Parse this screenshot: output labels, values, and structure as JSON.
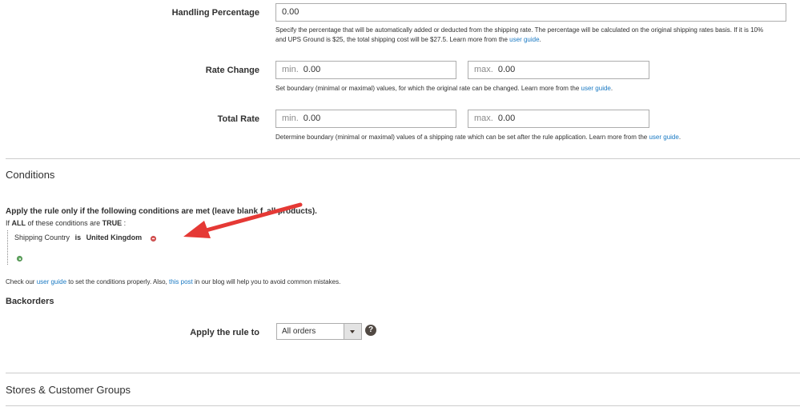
{
  "handling_percentage": {
    "label": "Handling Percentage",
    "value": "0.00",
    "note_line1": "Specify the percentage that will be automatically added or deducted from the shipping rate. The percentage will be calculated on the original shipping rates basis. If it is 10%",
    "note_line2": "and UPS Ground is $25, the total shipping cost will be $27.5. Learn more from the ",
    "note_link": "user guide",
    "note_end": "."
  },
  "rate_change": {
    "label": "Rate Change",
    "min_prefix": "min.",
    "min_value": "0.00",
    "max_prefix": "max.",
    "max_value": "0.00",
    "note": "Set boundary (minimal or maximal) values, for which the original rate can be changed. Learn more from the ",
    "note_link": "user guide",
    "note_end": "."
  },
  "total_rate": {
    "label": "Total Rate",
    "min_prefix": "min.",
    "min_value": "0.00",
    "max_prefix": "max.",
    "max_value": "0.00",
    "note": "Determine boundary (minimal or maximal) values of a shipping rate which can be set after the rule application. Learn more from the ",
    "note_link": "user guide",
    "note_end": "."
  },
  "conditions": {
    "title": "Conditions",
    "apply_text_part1": "Apply the rule only if the following conditions are met (leave blank f",
    "apply_text_part2": "all products).",
    "if_text": "If",
    "all_text": "ALL",
    "middle_text": "of these conditions are",
    "true_text": "TRUE",
    "colon": ":",
    "condition_attribute": "Shipping Country",
    "condition_operator": "is",
    "condition_value": "United Kingdom",
    "check_text": "Check our ",
    "check_link1": "user guide",
    "check_mid": " to set the conditions properly. Also, ",
    "check_link2": "this post",
    "check_end": " in our blog will help you to avoid common mistakes."
  },
  "backorders": {
    "title": "Backorders",
    "apply_label": "Apply the rule to",
    "selected": "All orders",
    "help": "?"
  },
  "stores": {
    "title": "Stores & Customer Groups"
  },
  "colors": {
    "link": "#1979c3",
    "arrow": "#e53935"
  }
}
